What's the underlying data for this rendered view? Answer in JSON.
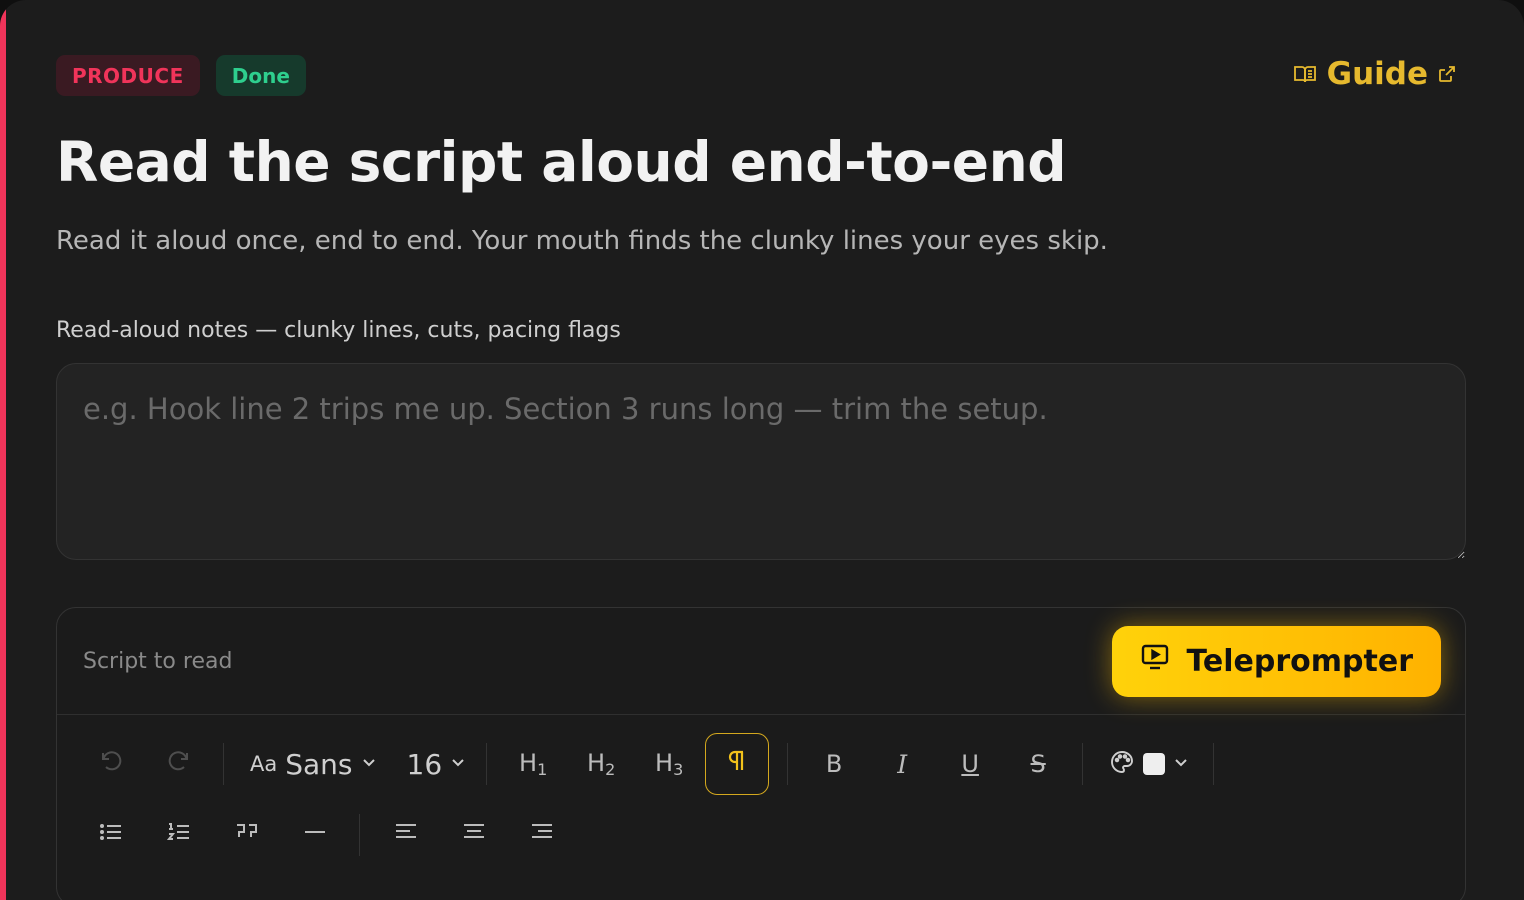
{
  "badges": {
    "stage": "PRODUCE",
    "status": "Done"
  },
  "guide": {
    "label": "Guide"
  },
  "title": "Read the script aloud end-to-end",
  "subtitle": "Read it aloud once, end to end. Your mouth finds the clunky lines your eyes skip.",
  "notes": {
    "label": "Read-aloud notes — clunky lines, cuts, pacing flags",
    "placeholder": "e.g. Hook line 2 trips me up. Section 3 runs long — trim the setup.",
    "value": ""
  },
  "editor": {
    "title": "Script to read",
    "teleprompter_label": "Teleprompter",
    "font_family": "Sans",
    "font_prefix": "Aa",
    "font_size": "16",
    "headings": [
      "H",
      "H",
      "H"
    ],
    "heading_levels": [
      "1",
      "2",
      "3"
    ],
    "bold": "B",
    "italic": "I",
    "underline": "U",
    "strike": "S",
    "text_color": "#eeeeee"
  },
  "colors": {
    "accent_produce": "#f0345a",
    "accent_done": "#2ecf8e",
    "guide": "#e6b92e",
    "teleprompter": "#ffc400"
  }
}
